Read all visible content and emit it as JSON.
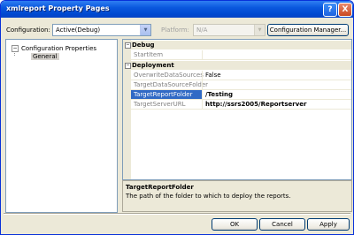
{
  "window": {
    "title": "xmlreport Property Pages"
  },
  "titlebar_buttons": {
    "help": "?",
    "close": "X"
  },
  "header": {
    "configuration_label": "Configuration:",
    "configuration_value": "Active(Debug)",
    "platform_label": "Platform:",
    "platform_value": "N/A",
    "config_manager_button": "Configuration Manager..."
  },
  "tree": {
    "toggle": "−",
    "root": "Configuration Properties",
    "child": "General"
  },
  "grid": {
    "categories": [
      {
        "label": "Debug",
        "toggle": "−",
        "rows": [
          {
            "name": "StartItem",
            "value": ""
          }
        ]
      },
      {
        "label": "Deployment",
        "toggle": "−",
        "rows": [
          {
            "name": "OverwriteDataSources",
            "value": "False"
          },
          {
            "name": "TargetDataSourceFolder",
            "value": ""
          },
          {
            "name": "TargetReportFolder",
            "value": "/Testing",
            "selected": true
          },
          {
            "name": "TargetServerURL",
            "value": "http://ssrs2005/Reportserver"
          }
        ]
      }
    ]
  },
  "description": {
    "title": "TargetReportFolder",
    "text": "The path of the folder to which to deploy the reports."
  },
  "footer": {
    "ok": "OK",
    "cancel": "Cancel",
    "apply": "Apply"
  }
}
